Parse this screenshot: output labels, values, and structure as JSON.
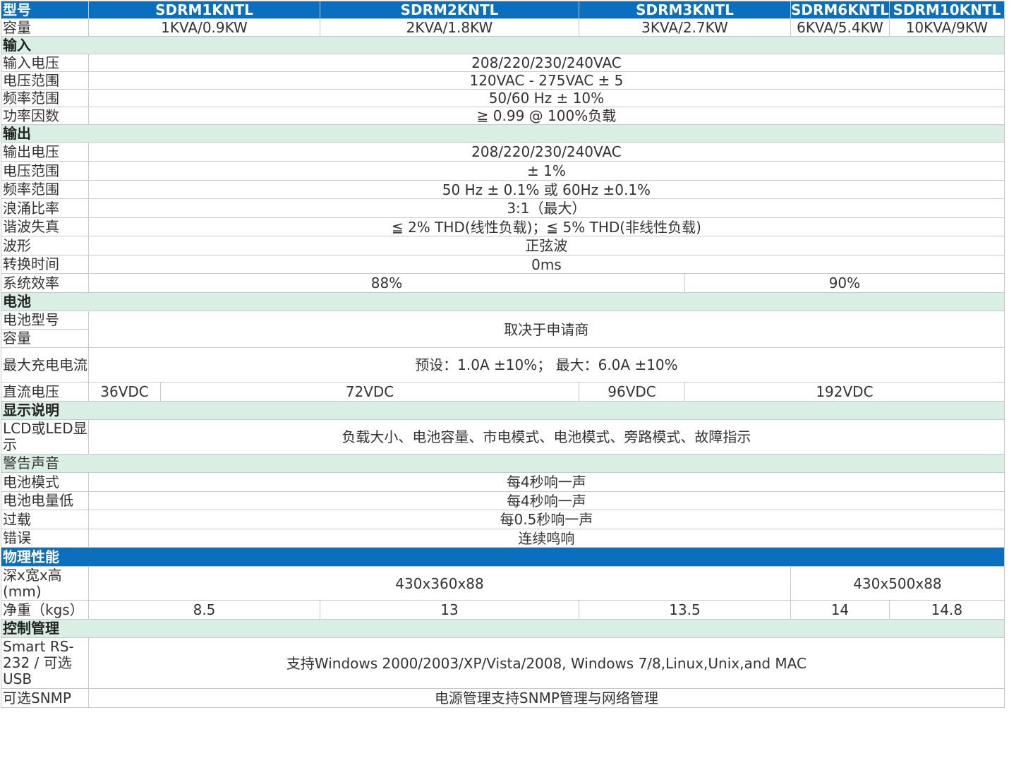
{
  "header": {
    "label": "型号",
    "models": [
      "SDRM1KNTL",
      "SDRM2KNTL",
      "SDRM3KNTL",
      "SDRM6KNTL",
      "SDRM10KNTL"
    ]
  },
  "capacity": {
    "label": "容量",
    "values": [
      "1KVA/0.9KW",
      "2KVA/1.8KW",
      "3KVA/2.7KW",
      "6KVA/5.4KW",
      "10KVA/9KW"
    ]
  },
  "input": {
    "section": "输入",
    "voltage": {
      "label": "输入电压",
      "value": "208/220/230/240VAC"
    },
    "voltage_range": {
      "label": "电压范围",
      "value": "120VAC - 275VAC ± 5"
    },
    "freq_range": {
      "label": "频率范围",
      "value": "50/60 Hz ± 10%"
    },
    "power_factor": {
      "label": "功率因数",
      "value": "≧ 0.99 @ 100%负载"
    }
  },
  "output": {
    "section": "输出",
    "voltage": {
      "label": "输出电压",
      "value": "208/220/230/240VAC"
    },
    "voltage_range": {
      "label": "电压范围",
      "value": "± 1%"
    },
    "freq_range": {
      "label": "频率范围",
      "value": "50 Hz ± 0.1% 或 60Hz ±0.1%"
    },
    "crest_ratio": {
      "label": "浪涌比率",
      "value": "3:1（最大）"
    },
    "thd": {
      "label": "谐波失真",
      "value": "≦ 2% THD(线性负载)；≦ 5% THD(非线性负载)"
    },
    "waveform": {
      "label": "波形",
      "value": "正弦波"
    },
    "transfer_time": {
      "label": "转换时间",
      "value": "0ms"
    },
    "efficiency": {
      "label": "系统效率",
      "values": [
        "88%",
        "90%"
      ]
    }
  },
  "battery": {
    "section": "电池",
    "type_label": "电池型号",
    "capacity_label": "容量",
    "type_value": "取决于申请商",
    "charge": {
      "label": "最大充电电流",
      "value": "预设：1.0A ±10%；  最大：6.0A ±10%"
    },
    "dc_voltage": {
      "label": "直流电压",
      "values": [
        "36VDC",
        "72VDC",
        "96VDC",
        "192VDC"
      ]
    }
  },
  "display": {
    "section": "显示说明",
    "lcd": {
      "label": "LCD或LED显示",
      "value": "负载大小、电池容量、市电模式、电池模式、旁路模式、故障指示"
    }
  },
  "alarm": {
    "section": "警告声音",
    "battery_mode": {
      "label": "电池模式",
      "value": "每4秒响一声"
    },
    "low_battery": {
      "label": "电池电量低",
      "value": "每4秒响一声"
    },
    "overload": {
      "label": "过载",
      "value": "每0.5秒响一声"
    },
    "fault": {
      "label": "错误",
      "value": "连续鸣响"
    }
  },
  "physical": {
    "section": "物理性能",
    "dimensions": {
      "label": "深x宽x高(mm)",
      "values": [
        "430x360x88",
        "430x500x88"
      ]
    },
    "weight": {
      "label": "净重（kgs）",
      "values": [
        "8.5",
        "13",
        "13.5",
        "14",
        "14.8"
      ]
    }
  },
  "control": {
    "section": "控制管理",
    "rs232": {
      "label": "Smart RS-232 / 可选USB",
      "value": "支持Windows 2000/2003/XP/Vista/2008, Windows 7/8,Linux,Unix,and MAC"
    },
    "snmp": {
      "label": "可选SNMP",
      "value": "电源管理支持SNMP管理与网络管理"
    }
  },
  "colors": {
    "header_blue": "#0a6fbf",
    "section_green": "#d9efe3",
    "border": "#c8c8c8"
  }
}
